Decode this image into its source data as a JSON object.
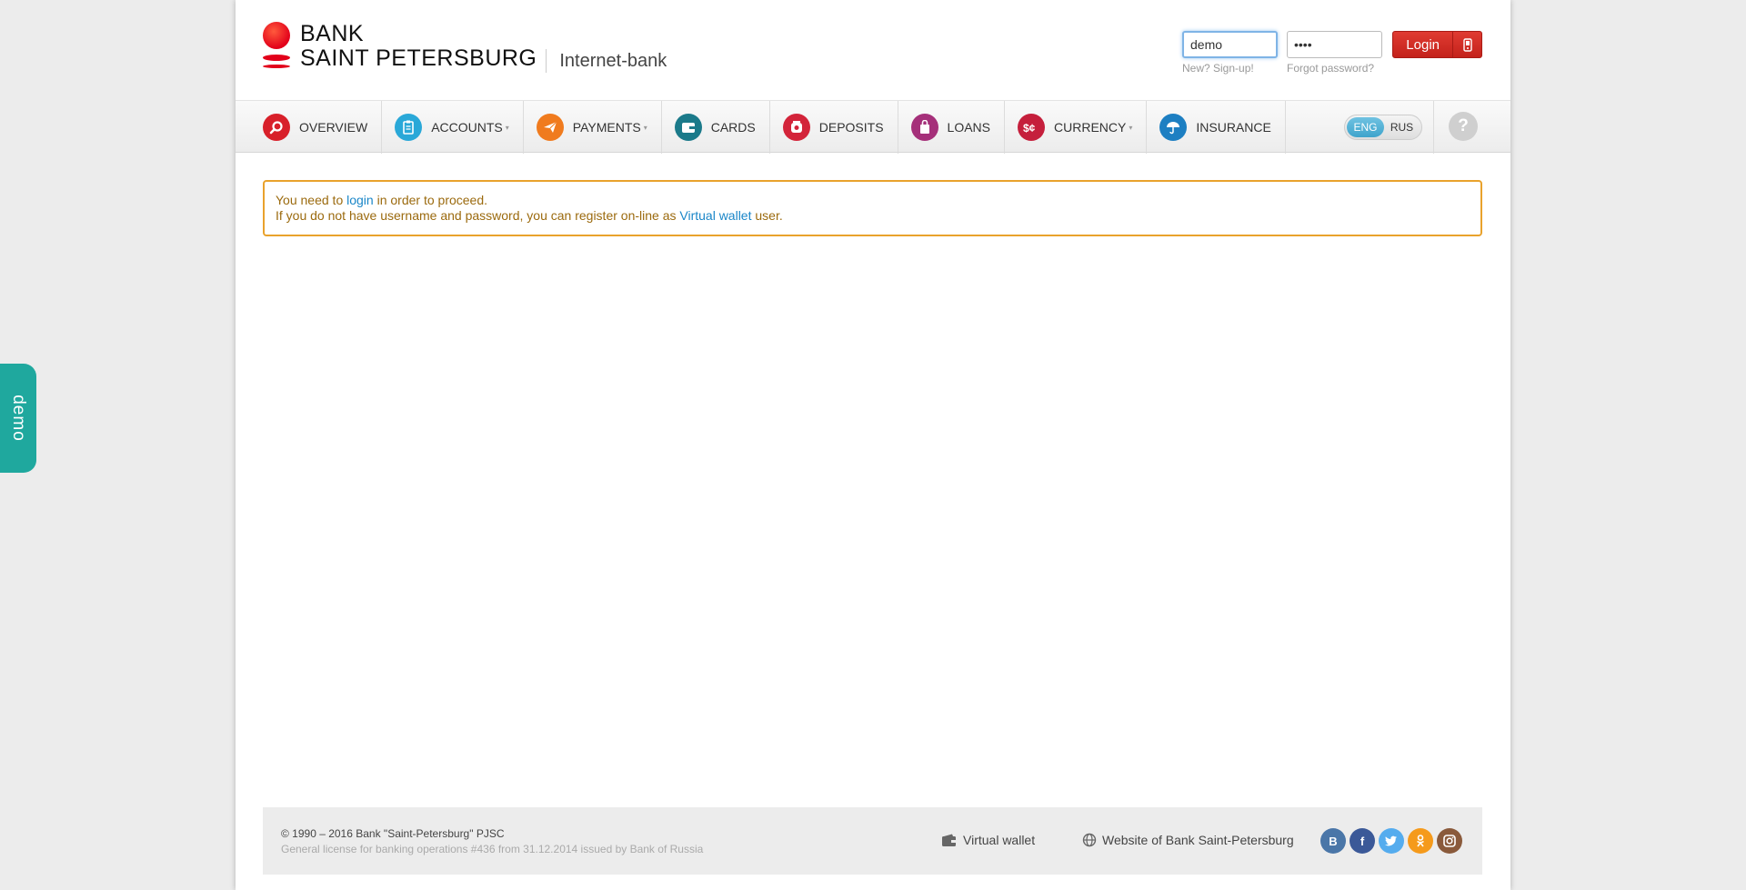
{
  "logo": {
    "line1": "BANK",
    "line2": "SAINT PETERSBURG",
    "subtitle": "Internet-bank"
  },
  "login": {
    "username_value": "demo",
    "password_value": "••••",
    "signup_hint": "New? Sign-up!",
    "forgot_hint": "Forgot password?",
    "button_label": "Login"
  },
  "nav": {
    "items": [
      {
        "label": "OVERVIEW",
        "icon": "search-icon",
        "color": "#d8202a"
      },
      {
        "label": "ACCOUNTS",
        "icon": "clipboard-icon",
        "color": "#2aa8d8"
      },
      {
        "label": "PAYMENTS",
        "icon": "paper-plane-icon",
        "color": "#f07b1e"
      },
      {
        "label": "CARDS",
        "icon": "wallet-icon",
        "color": "#1b7a8a"
      },
      {
        "label": "DEPOSITS",
        "icon": "piggy-icon",
        "color": "#d3243a"
      },
      {
        "label": "LOANS",
        "icon": "bag-icon",
        "color": "#a5307a"
      },
      {
        "label": "CURRENCY",
        "icon": "currency-icon",
        "color": "#c51f3c"
      },
      {
        "label": "INSURANCE",
        "icon": "umbrella-icon",
        "color": "#1d7fc2"
      }
    ],
    "lang_active": "ENG",
    "lang_other": "RUS",
    "help": "?"
  },
  "alert": {
    "line1_before": "You need to ",
    "line1_link": "login",
    "line1_after": " in order to proceed.",
    "line2_before": "If you do not have username and password, you can register on-line as ",
    "line2_link": "Virtual wallet",
    "line2_after": " user."
  },
  "footer": {
    "copyright": "© 1990 – 2016 Bank \"Saint-Petersburg\" PJSC",
    "license": "General license for banking operations #436 from 31.12.2014 issued by Bank of Russia",
    "virtual_wallet": "Virtual wallet",
    "website": "Website of Bank Saint-Petersburg",
    "socials": [
      {
        "label": "B",
        "color": "#4a76a8"
      },
      {
        "label": "f",
        "color": "#3b5998"
      },
      {
        "label": "t",
        "color": "#55acee"
      },
      {
        "label": "ok",
        "color": "#f59a1b"
      },
      {
        "label": "ig",
        "color": "#8a5a3b"
      }
    ]
  },
  "demo_tab": "demo"
}
